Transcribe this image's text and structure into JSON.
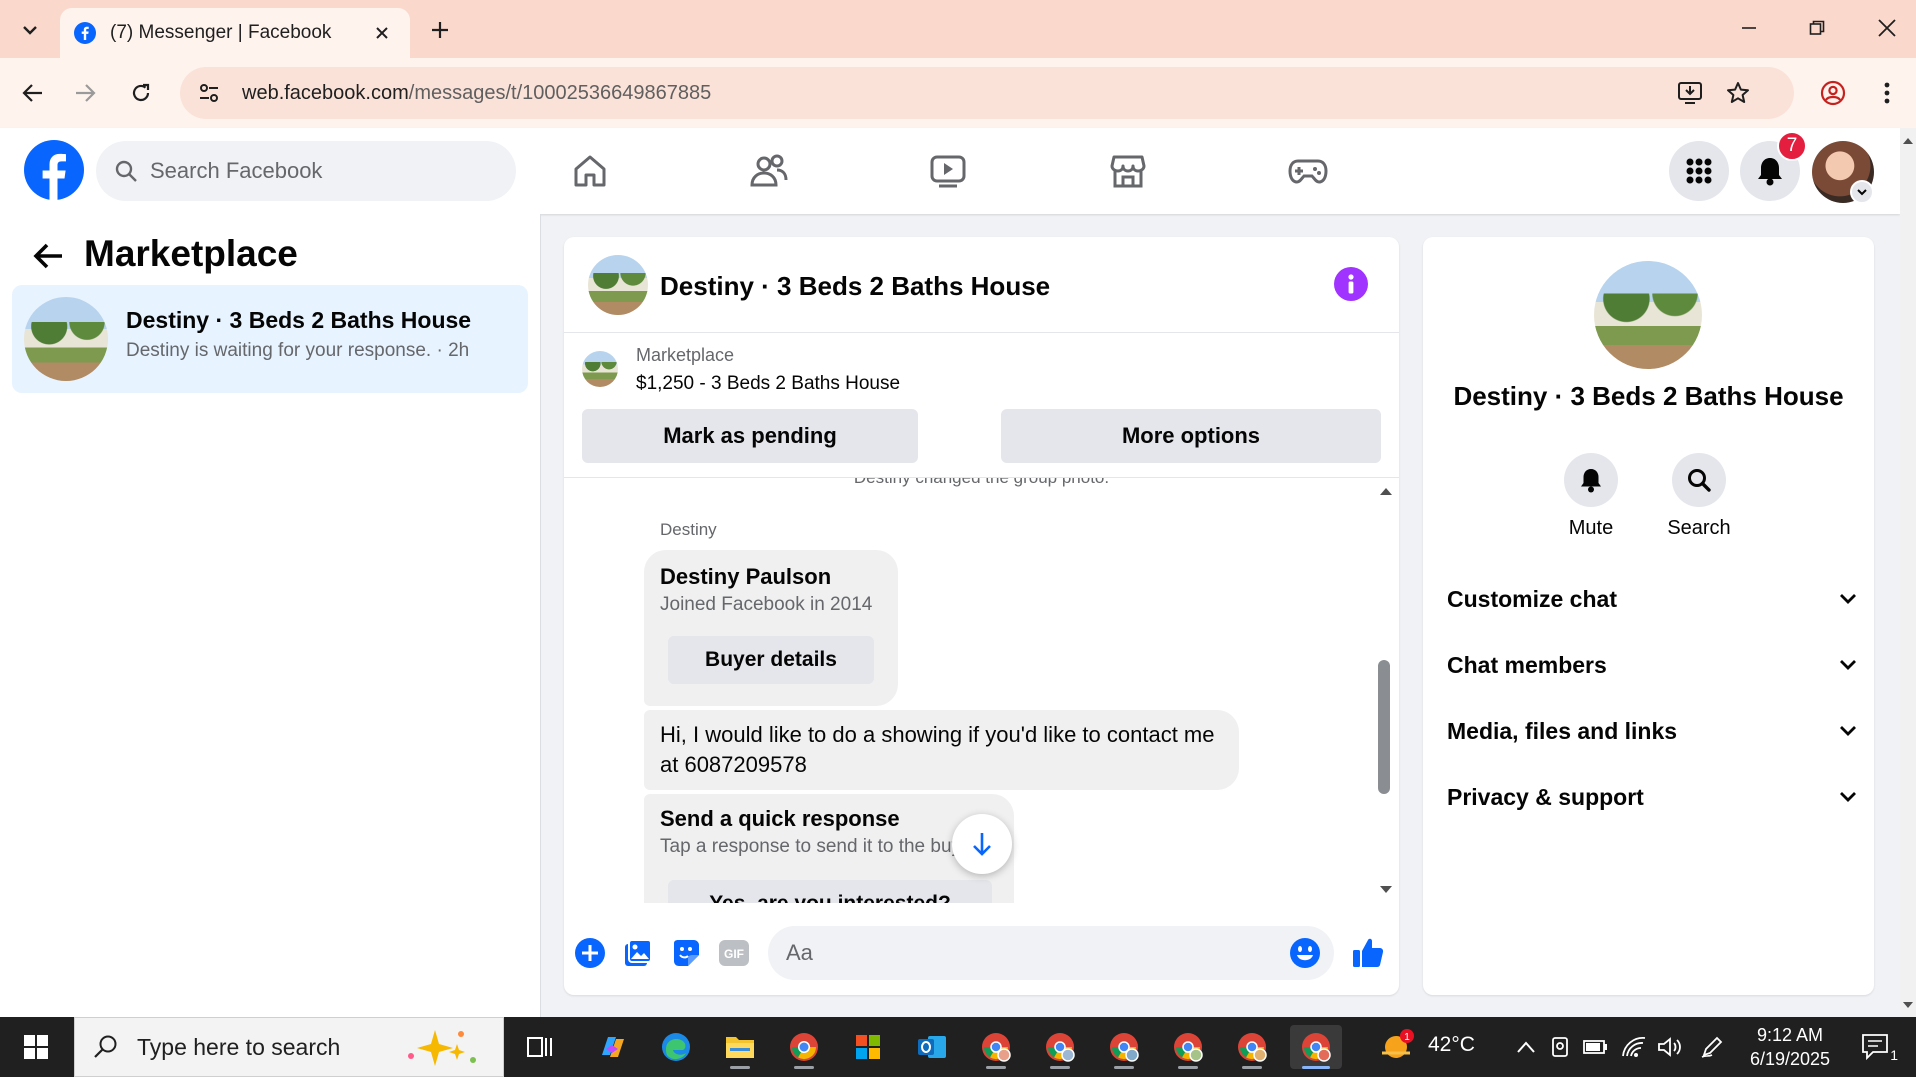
{
  "browser": {
    "tab_title": "(7) Messenger | Facebook",
    "url_host": "web.facebook.com",
    "url_path": "/messages/t/10002536649867885"
  },
  "fb_header": {
    "search_placeholder": "Search Facebook",
    "notification_count": "7",
    "brand_color": "#0866ff",
    "badge_color": "#e41e3f"
  },
  "left": {
    "title": "Marketplace",
    "conversation": {
      "name": "Destiny · 3 Beds 2 Baths House",
      "preview": "Destiny is waiting for your response. · 2h"
    }
  },
  "chat": {
    "title": "Destiny · 3 Beds 2 Baths House",
    "listing_label": "Marketplace",
    "listing_price": "$1,250 - 3 Beds 2 Baths House",
    "mark_pending": "Mark as pending",
    "more_options": "More options",
    "system_message": "Destiny changed the group photo.",
    "sender": "Destiny",
    "profile_card": {
      "name": "Destiny Paulson",
      "joined": "Joined Facebook in 2014",
      "button": "Buyer details"
    },
    "message": "Hi, I would like to do a showing if you'd like to contact me at 6087209578",
    "quick_response": {
      "title": "Send a quick response",
      "subtitle": "Tap a response to send it to the buyer",
      "option": "Yes, are you interested?"
    },
    "input_placeholder": "Aa",
    "accent_color": "#0866ff"
  },
  "right_panel": {
    "name": "Destiny · 3 Beds 2 Baths House",
    "actions": [
      {
        "label": "Mute",
        "icon": "bell-icon"
      },
      {
        "label": "Search",
        "icon": "search-icon"
      }
    ],
    "sections": [
      {
        "label": "Customize chat"
      },
      {
        "label": "Chat members"
      },
      {
        "label": "Media, files and links"
      },
      {
        "label": "Privacy & support"
      }
    ]
  },
  "taskbar": {
    "search_placeholder": "Type here to search",
    "temperature": "42°C",
    "time": "9:12 AM",
    "date": "6/19/2025",
    "notification_count": "1"
  }
}
